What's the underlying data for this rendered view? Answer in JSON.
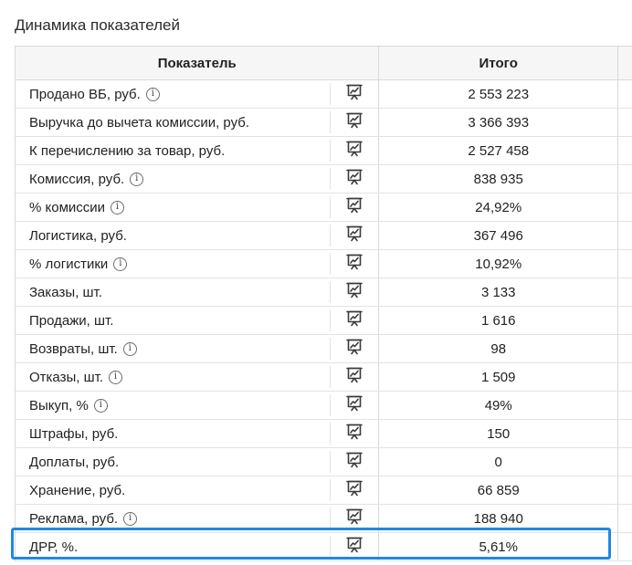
{
  "section_title": "Динамика показателей",
  "table": {
    "header": {
      "indicator": "Показатель",
      "total": "Итого"
    },
    "rows": [
      {
        "label": "Продано ВБ, руб.",
        "info": true,
        "value": "2 553 223"
      },
      {
        "label": "Выручка до вычета комиссии, руб.",
        "info": false,
        "value": "3 366 393"
      },
      {
        "label": "К перечислению за товар, руб.",
        "info": false,
        "value": "2 527 458"
      },
      {
        "label": "Комиссия, руб.",
        "info": true,
        "value": "838 935"
      },
      {
        "label": "% комиссии",
        "info": true,
        "value": "24,92%"
      },
      {
        "label": "Логистика, руб.",
        "info": false,
        "value": "367 496"
      },
      {
        "label": "% логистики",
        "info": true,
        "value": "10,92%"
      },
      {
        "label": "Заказы, шт.",
        "info": false,
        "value": "3 133"
      },
      {
        "label": "Продажи, шт.",
        "info": false,
        "value": "1 616"
      },
      {
        "label": "Возвраты, шт.",
        "info": true,
        "value": "98"
      },
      {
        "label": "Отказы, шт.",
        "info": true,
        "value": "1 509"
      },
      {
        "label": "Выкуп, %",
        "info": true,
        "value": "49%"
      },
      {
        "label": "Штрафы, руб.",
        "info": false,
        "value": "150"
      },
      {
        "label": "Доплаты, руб.",
        "info": false,
        "value": "0"
      },
      {
        "label": "Хранение, руб.",
        "info": false,
        "value": "66 859"
      },
      {
        "label": "Реклама, руб.",
        "info": true,
        "value": "188 940"
      },
      {
        "label": "ДРР, %.",
        "info": false,
        "value": "5,61%",
        "highlighted": true
      }
    ]
  },
  "icons": {
    "info": "info-icon",
    "chart": "chart-presentation-icon"
  },
  "info_glyph": "i",
  "colors": {
    "highlight": "#1e88e5",
    "header_bg": "#f6f6f7",
    "border": "#d9d9d9"
  }
}
